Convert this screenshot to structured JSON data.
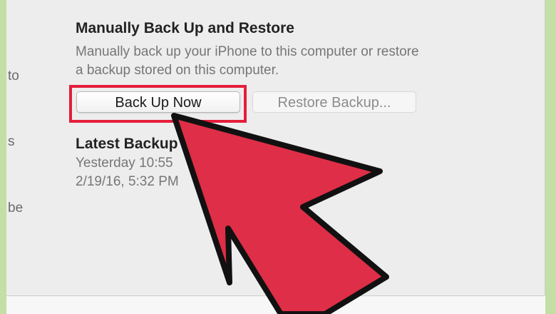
{
  "left_fragments": [
    "to",
    "s",
    "be"
  ],
  "backup_section": {
    "title": "Manually Back Up and Restore",
    "description_line1": "Manually back up your iPhone to this computer or restore",
    "description_line2": "a backup stored on this computer.",
    "back_up_now_label": "Back Up Now",
    "restore_backup_label": "Restore Backup..."
  },
  "latest_backup": {
    "title": "Latest Backup",
    "line1": "Yesterday 10:55",
    "line2": "2/19/16, 5:32 PM"
  },
  "colors": {
    "highlight": "#e41e3b",
    "arrow_fill": "#df2e47",
    "background_border": "#c3dfa6"
  }
}
